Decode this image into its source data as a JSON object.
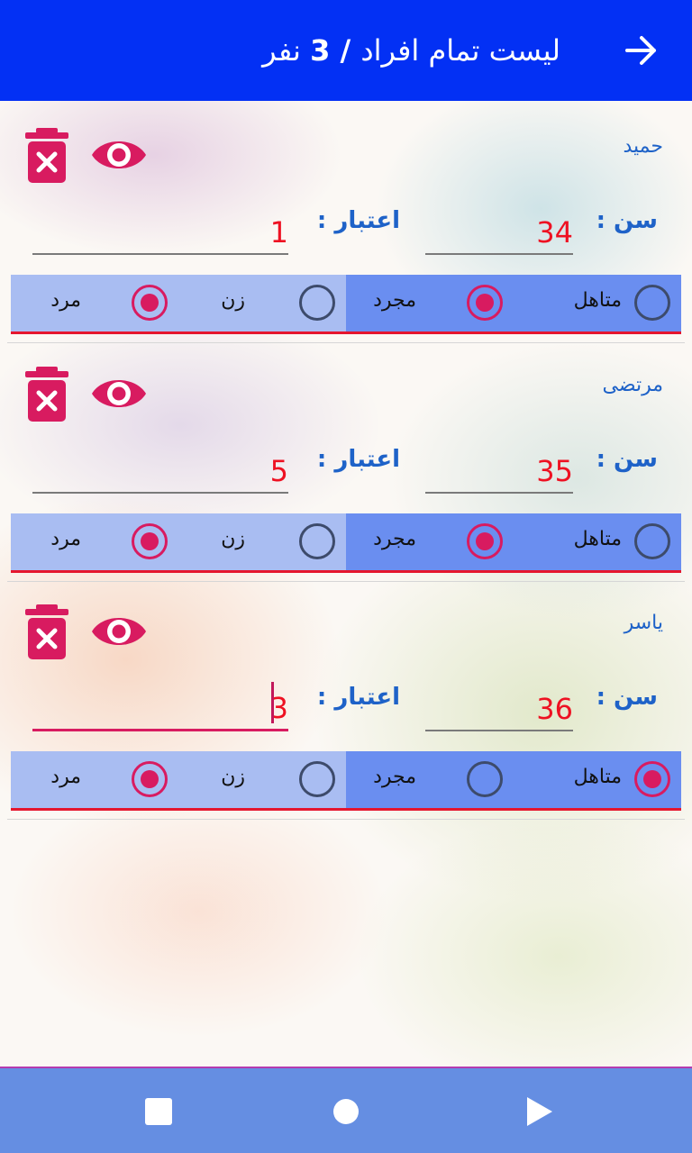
{
  "app_bar": {
    "title_prefix": "لیست تمام افراد",
    "separator": " / ",
    "count": "3",
    "title_suffix": " نفر",
    "back_icon": "arrow-right-icon",
    "color": "#0330f4"
  },
  "labels": {
    "age": "سن :",
    "credit": "اعتبار :",
    "married": "متاهل",
    "single": "مجرد",
    "female": "زن",
    "male": "مرد"
  },
  "persons": [
    {
      "name": "حمید",
      "age": "34",
      "credit": "1",
      "marital": "single",
      "gender": "male",
      "focused": false
    },
    {
      "name": "مرتضی",
      "age": "35",
      "credit": "5",
      "marital": "single",
      "gender": "male",
      "focused": false
    },
    {
      "name": "یاسر",
      "age": "36",
      "credit": "3",
      "marital": "married",
      "gender": "male",
      "focused": true
    }
  ],
  "icons": {
    "delete": "trash-x-icon",
    "view": "eye-icon"
  },
  "colors": {
    "accent": "#d81b60",
    "value_red": "#ee1122",
    "label_blue": "#1e62c8",
    "gender_bg": "#a9bdf2",
    "marital_bg": "#6a8ef0",
    "nav_bg": "#658ee2"
  },
  "nav": {
    "recent_icon": "square-icon",
    "home_icon": "circle-icon",
    "back_icon": "triangle-back-icon"
  }
}
